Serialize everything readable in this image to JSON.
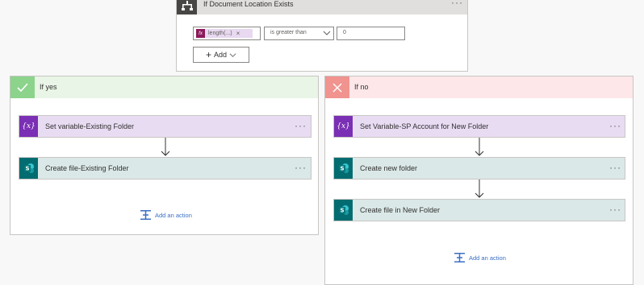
{
  "condition": {
    "title": "If Document Location Exists",
    "expression_token": "length(...)",
    "token_remove": "×",
    "operator": "is greater than",
    "value": "0",
    "add_button": "Add",
    "more": "···"
  },
  "branches": {
    "yes": {
      "label": "If yes",
      "actions": [
        {
          "title": "Set variable-Existing Folder",
          "icon": "variable-icon",
          "more": "···"
        },
        {
          "title": "Create file-Existing Folder",
          "icon": "sharepoint-icon",
          "more": "···"
        }
      ],
      "add_action": "Add an action"
    },
    "no": {
      "label": "If no",
      "actions": [
        {
          "title": "Set Variable-SP Account for New Folder",
          "icon": "variable-icon",
          "more": "···"
        },
        {
          "title": "Create new folder",
          "icon": "sharepoint-icon",
          "more": "···"
        },
        {
          "title": "Create file in New Folder",
          "icon": "sharepoint-icon",
          "more": "···"
        }
      ],
      "add_action": "Add an action"
    }
  },
  "icons": {
    "variable_glyph": "{x}",
    "fx_glyph": "fx"
  },
  "colors": {
    "yes_accent": "#8cd38c",
    "no_accent": "#f1938e",
    "variable_purple": "#7a2fb5",
    "sharepoint_teal": "#036c70",
    "link_blue": "#3a6fc4"
  }
}
